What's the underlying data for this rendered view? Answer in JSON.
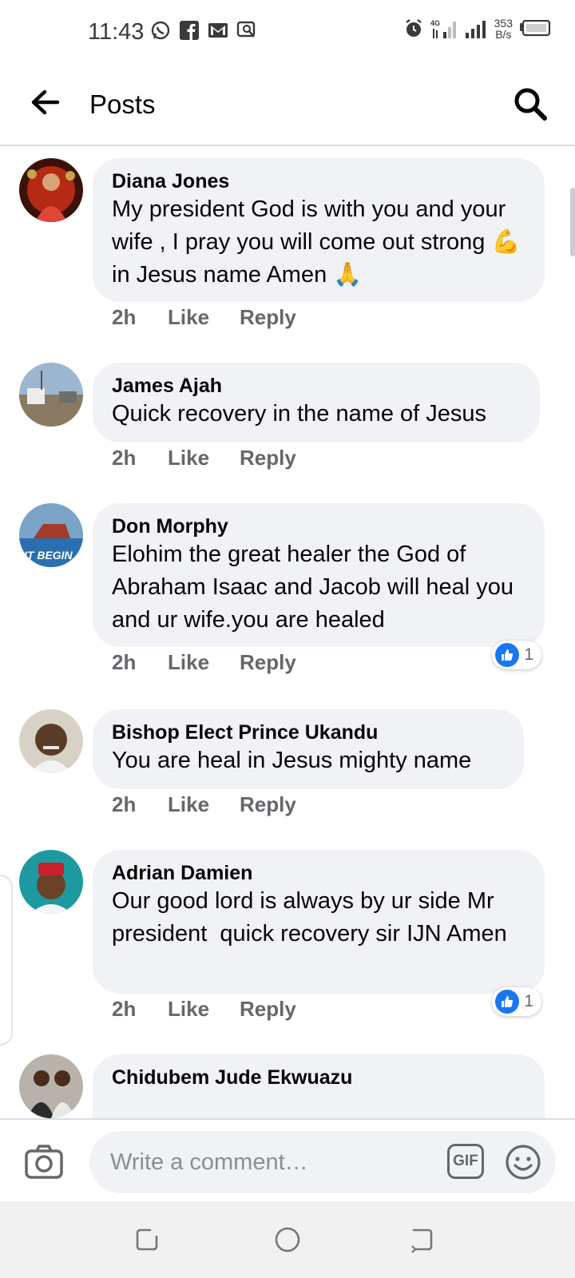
{
  "status_bar": {
    "time": "11:43",
    "net_speed_value": "353",
    "net_speed_unit": "B/s",
    "network": "4G"
  },
  "header": {
    "title": "Posts"
  },
  "comments": [
    {
      "author": "Diana Jones",
      "text": "My president God is with you and your wife , I pray you will come out strong 💪 in Jesus name Amen 🙏",
      "time": "2h",
      "like": "Like",
      "reply": "Reply",
      "reactions": ""
    },
    {
      "author": "James Ajah",
      "text": "Quick recovery in the name of Jesus",
      "time": "2h",
      "like": "Like",
      "reply": "Reply",
      "reactions": ""
    },
    {
      "author": "Don Morphy",
      "text": "Elohim the great healer the God of Abraham Isaac and Jacob will heal you and ur wife.you are healed",
      "time": "2h",
      "like": "Like",
      "reply": "Reply",
      "reactions": "1"
    },
    {
      "author": "Bishop Elect Prince Ukandu",
      "text": "You are heal in Jesus mighty name",
      "time": "2h",
      "like": "Like",
      "reply": "Reply",
      "reactions": ""
    },
    {
      "author": "Adrian Damien",
      "text": "Our good lord is always by ur side Mr president  quick recovery sir IJN Amen",
      "time": "2h",
      "like": "Like",
      "reply": "Reply",
      "reactions": "1"
    },
    {
      "author": "Chidubem Jude Ekwuazu",
      "text": "",
      "time": "",
      "like": "",
      "reply": "",
      "reactions": ""
    }
  ],
  "composer": {
    "placeholder": "Write a comment…",
    "gif_label": "GIF"
  },
  "avatar_text": "IT BEGIN",
  "colors": {
    "accent": "#1877f2",
    "bubble": "#f0f2f5",
    "secondary_text": "#65676b"
  }
}
